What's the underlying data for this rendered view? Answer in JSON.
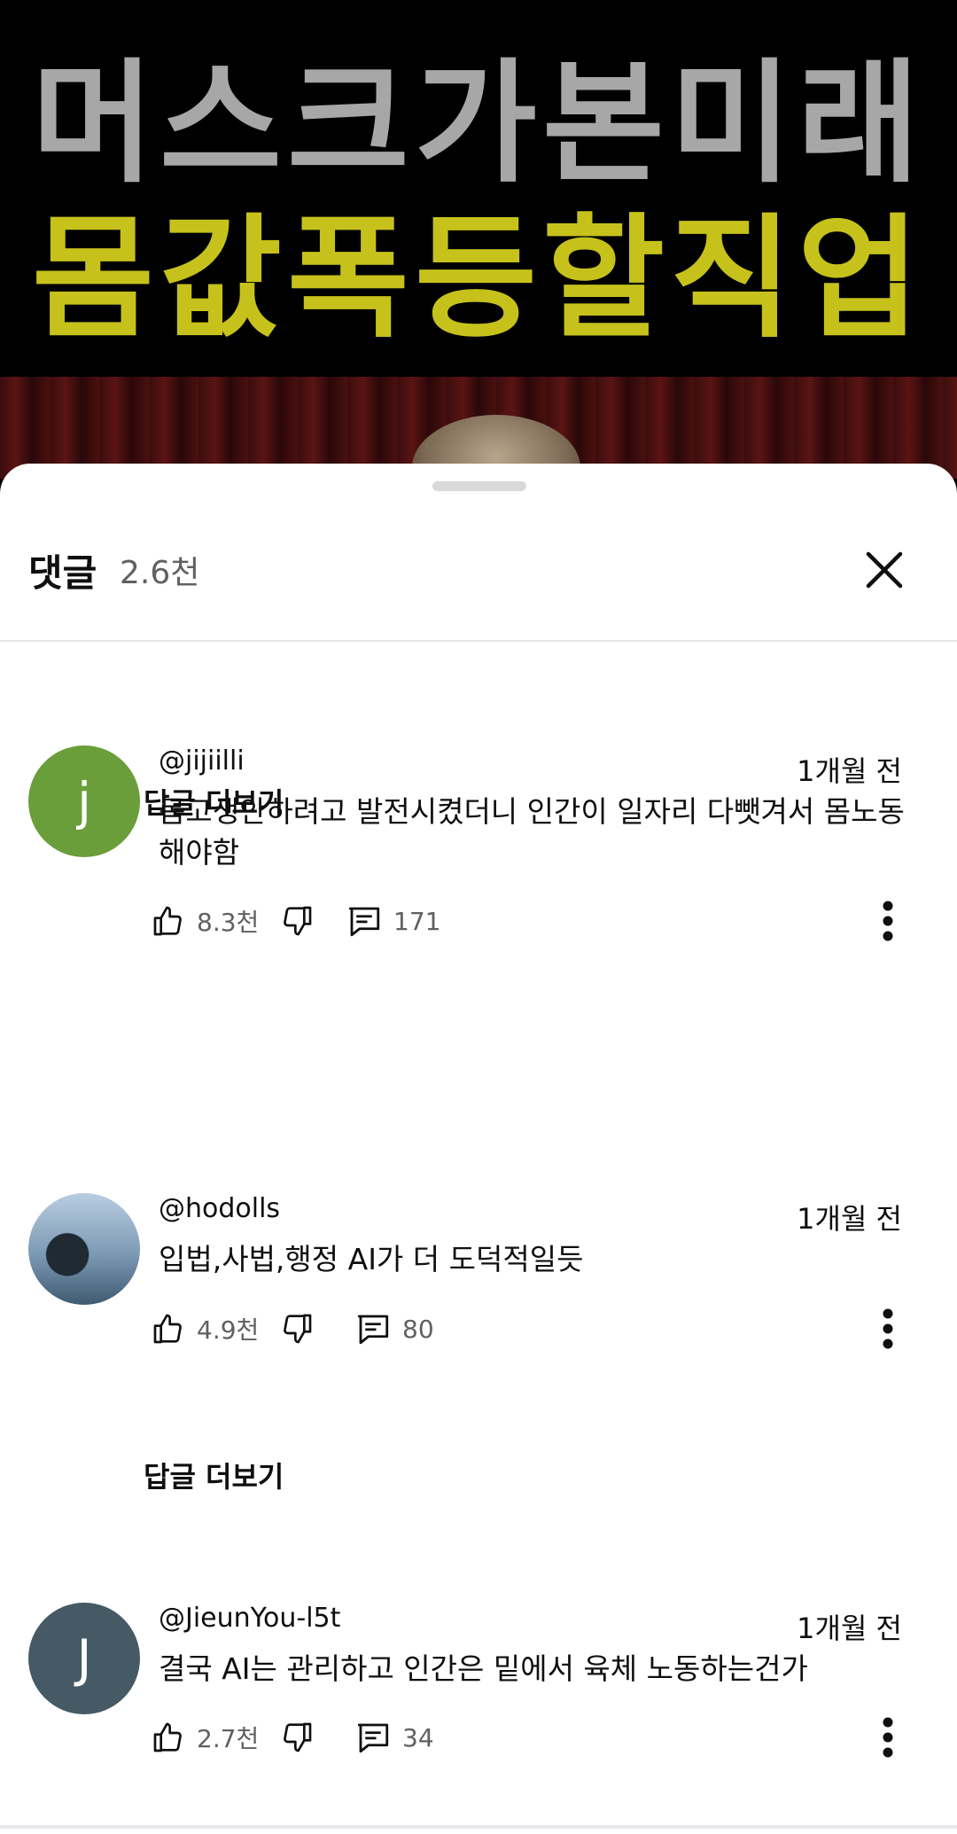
{
  "video": {
    "title_line1": "머스크가본미래",
    "title_line2": "몸값폭등할직업"
  },
  "comments_panel": {
    "title": "댓글",
    "count": "2.6천"
  },
  "comments": [
    {
      "author": "@jijiilli",
      "avatar_letter": "j",
      "avatar_color": "#6a9e3a",
      "time": "1개월 전",
      "text": "몸고생안하려고 발전시켰더니 인간이 일자리 다뺏겨서 몸노동해야함",
      "likes": "8.3천",
      "replies_count": "171",
      "replies_link": "답글 더보기"
    },
    {
      "author": "@hodolls",
      "avatar_letter": "",
      "avatar_color": "#6b8aa6",
      "time": "1개월 전",
      "text": "입법,사법,행정 AI가 더 도덕적일듯",
      "likes": "4.9천",
      "replies_count": "80",
      "replies_link": "답글 더보기"
    },
    {
      "author": "@JieunYou-l5t",
      "avatar_letter": "J",
      "avatar_color": "#455a64",
      "time": "1개월 전",
      "text": "결국 AI는 관리하고 인간은 밑에서 육체 노동하는건가",
      "likes": "2.7천",
      "replies_count": "34"
    }
  ]
}
